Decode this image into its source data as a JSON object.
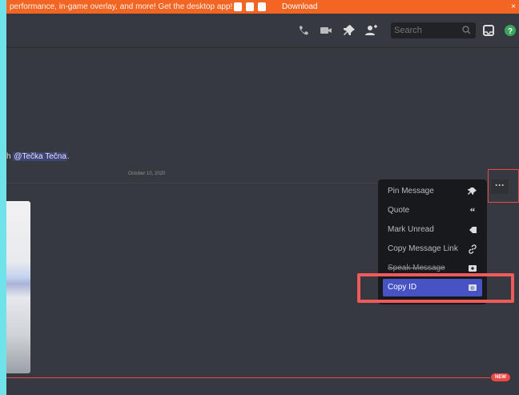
{
  "banner": {
    "message": "performance, in-game overlay, and more! Get the desktop app!",
    "download_label": "Download",
    "close_label": "×"
  },
  "header": {
    "search_placeholder": "Search"
  },
  "message": {
    "text_prefix": "h ",
    "mention": "@Tečka Tečna",
    "text_suffix": ".",
    "date": "October 10, 2020"
  },
  "more_button": {
    "label": "···"
  },
  "context_menu": {
    "items": [
      {
        "label": "Pin Message",
        "icon": "pin-icon"
      },
      {
        "label": "Quote",
        "icon": "quote-icon"
      },
      {
        "label": "Mark Unread",
        "icon": "mark-unread-icon"
      },
      {
        "label": "Copy Message Link",
        "icon": "link-icon"
      },
      {
        "label": "Speak Message",
        "icon": "speak-icon"
      },
      {
        "label": "Copy ID",
        "icon": "id-icon"
      }
    ]
  },
  "new_badge": "NEW",
  "colors": {
    "banner": "#f26522",
    "background": "#36393f",
    "menu": "#18191c",
    "active": "#4752c4",
    "highlight": "#f05a5a",
    "new": "#f04747"
  }
}
